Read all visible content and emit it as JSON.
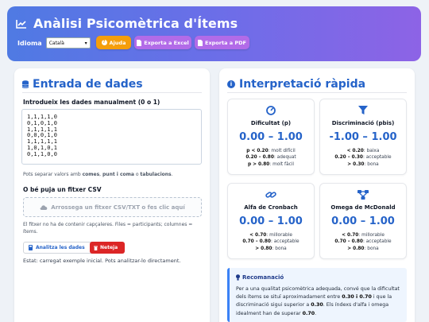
{
  "header": {
    "title": "Anàlisi Psicomètrica d'Ítems",
    "language_label": "Idioma",
    "language_value": "Català",
    "help_label": "Ajuda",
    "excel_label": "Exporta a Excel",
    "pdf_label": "Exporta a PDF",
    "help_color": "#f59e0b",
    "export_color": "#b26be8"
  },
  "left": {
    "title": "Entrada de dades",
    "manual_label": "Introdueix les dades manualment (0 o 1)",
    "textarea_value": "1,1,1,1,0\n0,1,0,1,0\n1,1,1,1,1\n0,0,0,1,0\n1,1,1,1,1\n1,0,1,0,1\n0,1,1,0,0",
    "hint_pre": "Pots separar valors amb ",
    "hint_commas": "comes",
    "hint_sep1": ", ",
    "hint_semicolon": "punt i coma",
    "hint_or": " o ",
    "hint_tabs": "tabulacions",
    "hint_end": ".",
    "csv_label": "O bé puja un fitxer CSV",
    "dropzone_text": "Arrossega un fitxer CSV/TXT o fes clic aquí",
    "csv_hint": "El fitxer no ha de contenir capçaleres. Files = participants; columnes = ítems.",
    "analyze_label": "Analitza les dades",
    "clear_label": "Neteja",
    "status": "Estat: carregat exemple inicial. Pots analitzar-lo directament."
  },
  "right": {
    "title": "Interpretació ràpida",
    "cards": [
      {
        "title": "Dificultat (p)",
        "range": "0.00 – 1.00",
        "icon": "gauge-icon",
        "l1k": "p < 0.20",
        "l1v": ": molt difícil",
        "l2k": "0.20 – 0.80",
        "l2v": ": adequat",
        "l3k": "p > 0.80",
        "l3v": ": molt fàcil"
      },
      {
        "title": "Discriminació (pbis)",
        "range": "-1.00 – 1.00",
        "icon": "filter-icon",
        "l1k": "< 0.20",
        "l1v": ": baixa",
        "l2k": "0.20 – 0.30",
        "l2v": ": acceptable",
        "l3k": "> 0.30",
        "l3v": ": bona"
      },
      {
        "title": "Alfa de Cronbach",
        "range": "0.00 – 1.00",
        "icon": "link-icon",
        "l1k": "< 0.70",
        "l1v": ": millorable",
        "l2k": "0.70 – 0.80",
        "l2v": ": acceptable",
        "l3k": "> 0.80",
        "l3v": ": bona"
      },
      {
        "title": "Omega de McDonald",
        "range": "0.00 – 1.00",
        "icon": "network-icon",
        "l1k": "< 0.70",
        "l1v": ": millorable",
        "l2k": "0.70 – 0.80",
        "l2v": ": acceptable",
        "l3k": "> 0.80",
        "l3v": ": bona"
      }
    ],
    "rec_title": "Recomanació",
    "rec_p1": "Per a una qualitat psicomètrica adequada, convé que la dificultat dels ítems se situï aproximadament entre ",
    "rec_b1": "0.30 i 0.70",
    "rec_p2": " i que la discriminació sigui superior a ",
    "rec_b2": "0.30",
    "rec_p3": ". Els índexs d'alfa i omega idealment han de superar ",
    "rec_b3": "0.70",
    "rec_p4": "."
  },
  "colors": {
    "accent": "#2563c9",
    "danger": "#dc2626"
  }
}
